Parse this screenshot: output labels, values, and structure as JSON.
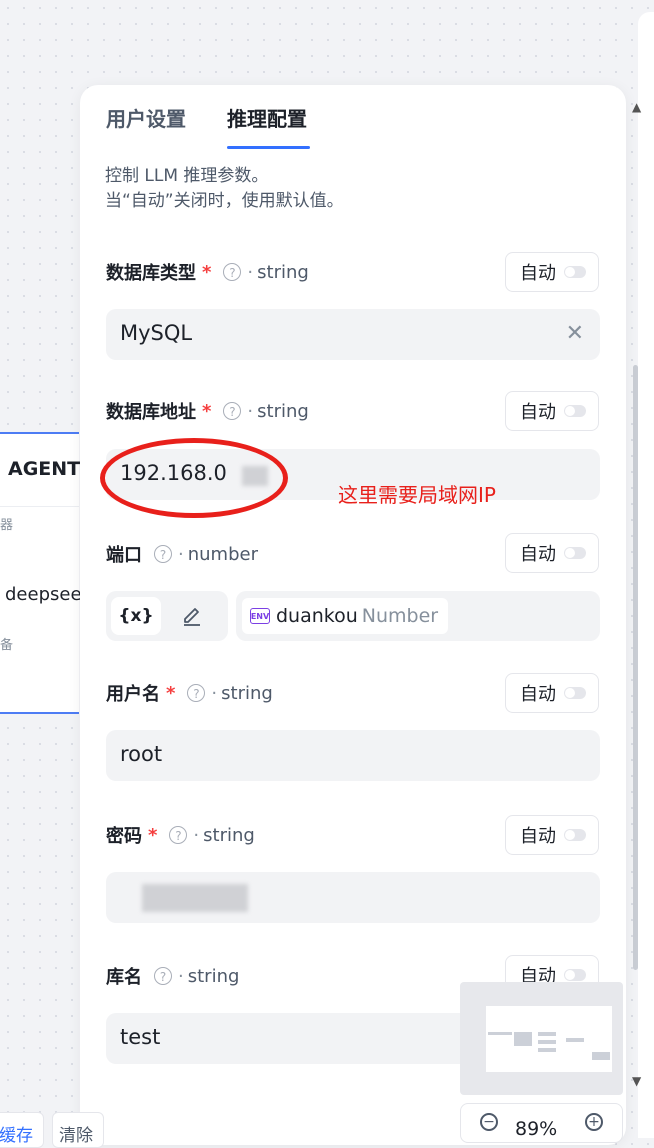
{
  "agent_node": {
    "title": "AGENT",
    "sub1": "器",
    "model": "deepseek",
    "sub2": "备"
  },
  "tabs": [
    {
      "label": "用户设置",
      "active": false
    },
    {
      "label": "推理配置",
      "active": true
    }
  ],
  "description": {
    "line1": "控制 LLM 推理参数。",
    "line2": "当“自动”关闭时，使用默认值。"
  },
  "auto_label": "自动",
  "fields": [
    {
      "label": "数据库类型",
      "required": true,
      "type": "string",
      "value": "MySQL",
      "clearable": true
    },
    {
      "label": "数据库地址",
      "required": true,
      "type": "string",
      "value": "192.168.0"
    },
    {
      "label": "端口",
      "required": false,
      "type": "number",
      "variable": {
        "icon": "ENV",
        "name": "duankou",
        "var_type": "Number"
      }
    },
    {
      "label": "用户名",
      "required": true,
      "type": "string",
      "value": "root"
    },
    {
      "label": "密码",
      "required": true,
      "type": "string",
      "value": ""
    },
    {
      "label": "库名",
      "required": false,
      "type": "string",
      "value": "test"
    }
  ],
  "var_toggle": {
    "expression_label": "{x}"
  },
  "annotation": {
    "text": "这里需要局域网IP",
    "color": "#e8201b"
  },
  "zoom": {
    "level": "89%"
  },
  "bottom_buttons": {
    "cache": "缓存",
    "clear": "清除"
  },
  "colors": {
    "accent": "#3370ff",
    "required": "#f53f3f",
    "env": "#7b3fe4"
  }
}
